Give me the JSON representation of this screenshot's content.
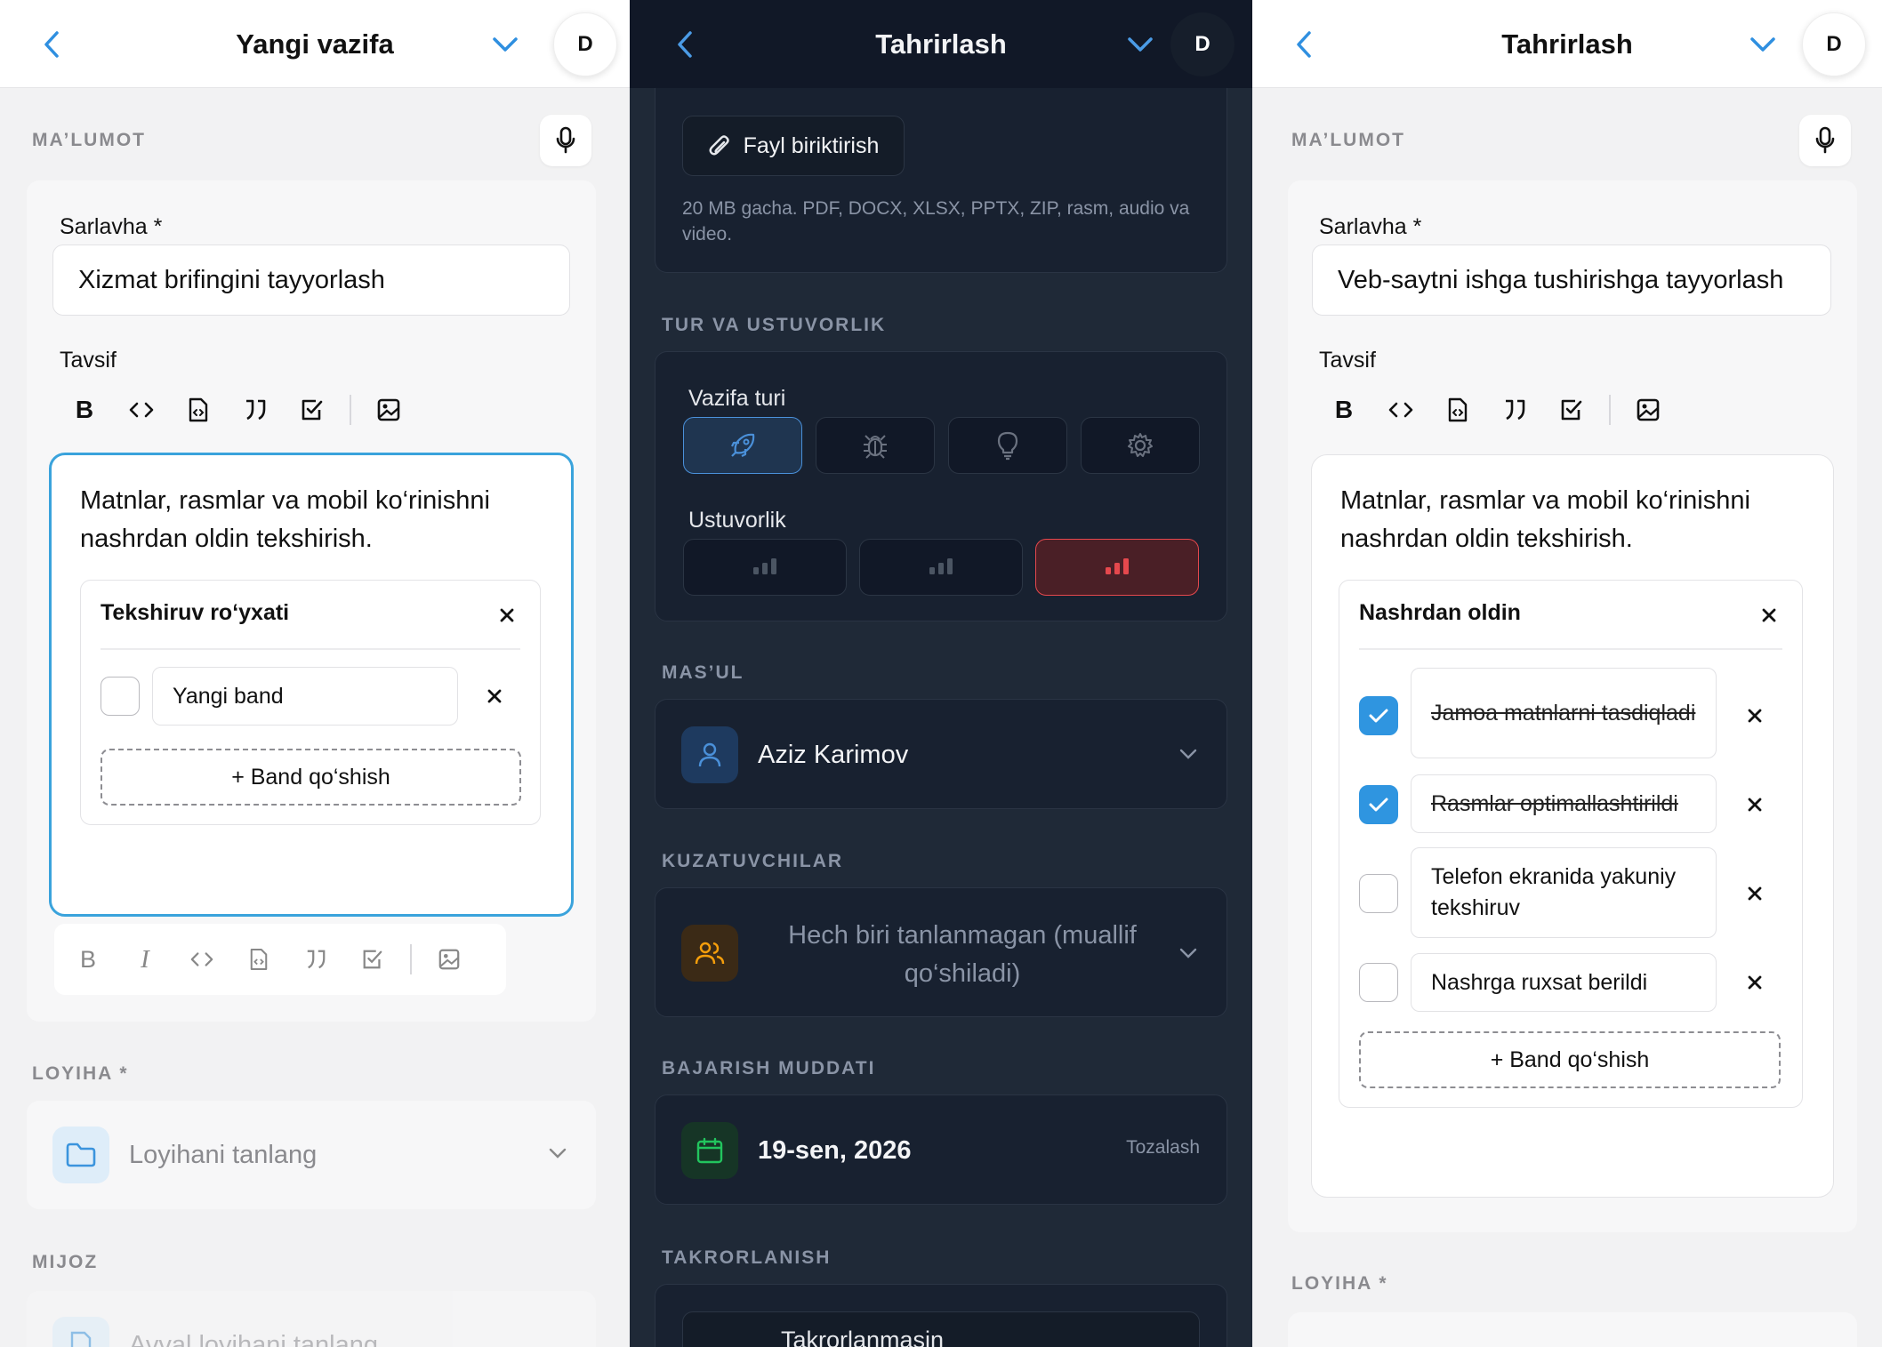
{
  "panel1": {
    "title": "Yangi vazifa",
    "avatar": "D",
    "section_info": "MA’LUMOT",
    "title_label": "Sarlavha *",
    "title_value": "Xizmat brifingini tayyorlash",
    "desc_label": "Tavsif",
    "editor_text": "Matnlar, rasmlar va mobil ko‘rinishni nashrdan oldin tekshirish.",
    "checklist": {
      "title": "Tekshiruv ro‘yxati",
      "items": [
        {
          "text": "Yangi band",
          "checked": false
        }
      ],
      "add_label": "+ Band qo‘shish"
    },
    "section_project": "LOYIHA *",
    "project_placeholder": "Loyihani tanlang",
    "section_client": "MIJOZ",
    "client_placeholder": "Avval loyihani tanlang"
  },
  "panel2": {
    "title": "Tahrirlash",
    "avatar": "D",
    "attach_label": "Fayl biriktirish",
    "attach_hint": "20 MB gacha. PDF, DOCX, XLSX, PPTX, ZIP, rasm, audio va video.",
    "section_type": "TUR VA USTUVORLIK",
    "type_label": "Vazifa turi",
    "type_options": [
      "rocket-icon",
      "bug-icon",
      "lightbulb-icon",
      "gear-icon"
    ],
    "type_selected": 0,
    "priority_label": "Ustuvorlik",
    "priority_selected": 2,
    "section_assignee": "MAS’UL",
    "assignee": "Aziz Karimov",
    "section_watchers": "KUZATUVCHILAR",
    "watchers_placeholder": "Hech biri tanlanmagan (muallif qo‘shiladi)",
    "section_due": "BAJARISH MUDDATI",
    "due_date": "19-sen, 2026",
    "clear_label": "Tozalash",
    "section_repeat": "TAKRORLANISH",
    "repeat_value": "Takrorlanmasin",
    "colors": {
      "accent": "#4a90d9",
      "danger": "#e5484d",
      "bg": "#1f2937"
    }
  },
  "panel3": {
    "title": "Tahrirlash",
    "avatar": "D",
    "section_info": "MA’LUMOT",
    "title_label": "Sarlavha *",
    "title_value": "Veb-saytni ishga tushirishga tayyorlash",
    "desc_label": "Tavsif",
    "editor_text": "Matnlar, rasmlar va mobil ko‘rinishni nashrdan oldin tekshirish.",
    "checklist": {
      "title": "Nashrdan oldin",
      "items": [
        {
          "text": "Jamoa matnlarni tasdiqladi",
          "checked": true
        },
        {
          "text": "Rasmlar optimallashtirildi",
          "checked": true
        },
        {
          "text": "Telefon ekranida yakuniy tekshiruv",
          "checked": false
        },
        {
          "text": "Nashrga ruxsat berildi",
          "checked": false
        }
      ],
      "add_label": "+ Band qo‘shish"
    },
    "section_project": "LOYIHA *"
  }
}
